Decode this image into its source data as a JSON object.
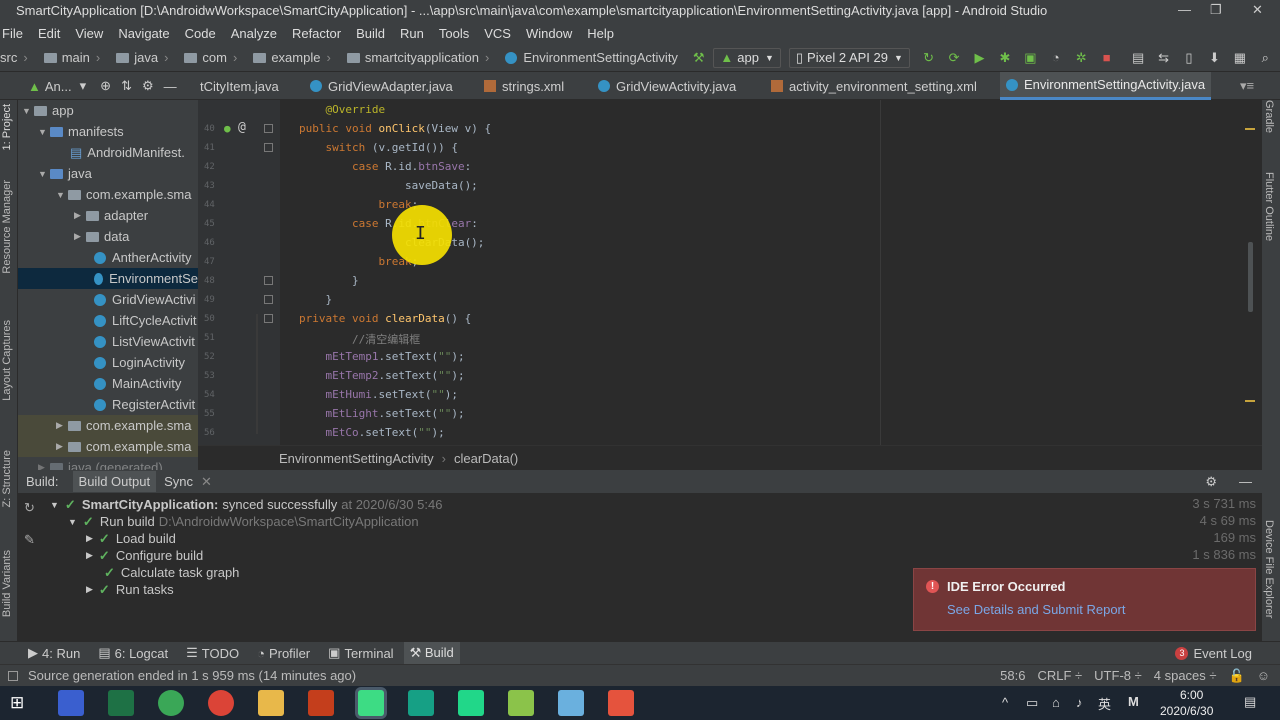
{
  "titlebar": {
    "title": "SmartCityApplication [D:\\AndroidwWorkspace\\SmartCityApplication] - ...\\app\\src\\main\\java\\com\\example\\smartcityapplication\\EnvironmentSettingActivity.java [app] - Android Studio"
  },
  "menu": [
    "File",
    "Edit",
    "View",
    "Navigate",
    "Code",
    "Analyze",
    "Refactor",
    "Build",
    "Run",
    "Tools",
    "VCS",
    "Window",
    "Help"
  ],
  "breadcrumbs": [
    "src",
    "main",
    "java",
    "com",
    "example",
    "smartcityapplication",
    "EnvironmentSettingActivity"
  ],
  "toolbar": {
    "config": "app",
    "device": "Pixel 2 API 29"
  },
  "tabs": [
    "tCityItem.java",
    "GridViewAdapter.java",
    "strings.xml",
    "GridViewActivity.java",
    "activity_environment_setting.xml",
    "EnvironmentSettingActivity.java"
  ],
  "project": {
    "header": "An...",
    "items": [
      {
        "label": "app",
        "level": 0,
        "arrow": "down"
      },
      {
        "label": "manifests",
        "level": 1,
        "arrow": "down"
      },
      {
        "label": "AndroidManifest.",
        "level": 2,
        "arrow": ""
      },
      {
        "label": "java",
        "level": 1,
        "arrow": "down"
      },
      {
        "label": "com.example.sma",
        "level": 2,
        "arrow": "down"
      },
      {
        "label": "adapter",
        "level": 3,
        "arrow": "right"
      },
      {
        "label": "data",
        "level": 3,
        "arrow": "right"
      },
      {
        "label": "AntherActivity",
        "level": 3,
        "arrow": ""
      },
      {
        "label": "EnvironmentSe",
        "level": 3,
        "arrow": ""
      },
      {
        "label": "GridViewActivi",
        "level": 3,
        "arrow": ""
      },
      {
        "label": "LiftCycleActivit",
        "level": 3,
        "arrow": ""
      },
      {
        "label": "ListViewActivit",
        "level": 3,
        "arrow": ""
      },
      {
        "label": "LoginActivity",
        "level": 3,
        "arrow": ""
      },
      {
        "label": "MainActivity",
        "level": 3,
        "arrow": ""
      },
      {
        "label": "RegisterActivit",
        "level": 3,
        "arrow": ""
      },
      {
        "label": "com.example.sma",
        "level": 2,
        "arrow": "right"
      },
      {
        "label": "com.example.sma",
        "level": 2,
        "arrow": "right"
      },
      {
        "label": "java (generated)",
        "level": 1,
        "arrow": "right"
      }
    ]
  },
  "left_strip": [
    "1: Project",
    "Resource Manager",
    "Layout Captures",
    "Z: Structure",
    "Build Variants"
  ],
  "right_strip": [
    "Gradle",
    "Flutter Outline",
    "Device File Explorer"
  ],
  "gutter_lines": [
    "",
    "40",
    "41",
    "42",
    "43",
    "44",
    "45",
    "46",
    "47",
    "48",
    "49",
    "50",
    "51",
    "52",
    "53",
    "54",
    "55",
    "56"
  ],
  "code": [
    "    @Override",
    "    public void onClick(View v) {",
    "        switch (v.getId()) {",
    "            case R.id.btnSave:",
    "                saveData();",
    "                break;",
    "            case R.id.btnClear:",
    "                clearData();",
    "                break;",
    "        }",
    "    }",
    "    private void clearData() {",
    "        //清空编辑框",
    "        mEtTemp1.setText(\"\");",
    "        mEtTemp2.setText(\"\");",
    "        mEtHumi.setText(\"\");",
    "        mEtLight.setText(\"\");",
    "        mEtCo.setText(\"\");"
  ],
  "editor_crumbs": [
    "EnvironmentSettingActivity",
    "clearData()"
  ],
  "build": {
    "tabs": [
      "Build:",
      "Build Output",
      "Sync"
    ],
    "rows": [
      {
        "label": "SmartCityApplication:",
        "extra": "synced successfully",
        "suffix": "at 2020/6/30 5:46",
        "time": "3 s 731 ms",
        "level": 0
      },
      {
        "label": "Run build",
        "extra": "",
        "suffix": "D:\\AndroidwWorkspace\\SmartCityApplication",
        "time": "4 s 69 ms",
        "level": 1
      },
      {
        "label": "Load build",
        "extra": "",
        "suffix": "",
        "time": "169 ms",
        "level": 2
      },
      {
        "label": "Configure build",
        "extra": "",
        "suffix": "",
        "time": "1 s 836 ms",
        "level": 2
      },
      {
        "label": "Calculate task graph",
        "extra": "",
        "suffix": "",
        "time": "",
        "level": 2
      },
      {
        "label": "Run tasks",
        "extra": "",
        "suffix": "",
        "time": "",
        "level": 2
      }
    ]
  },
  "toast": {
    "title": "IDE Error Occurred",
    "link": "See Details and Submit Report"
  },
  "toolwindows": [
    "4: Run",
    "6: Logcat",
    "TODO",
    "Profiler",
    "Terminal",
    "Build"
  ],
  "event_log": {
    "count": "3",
    "label": "Event Log"
  },
  "status": {
    "message": "Source generation ended in 1 s 959 ms (14 minutes ago)",
    "position": "58:6",
    "line_sep": "CRLF ÷",
    "encoding": "UTF-8 ÷",
    "indent": "4 spaces ÷"
  },
  "taskbar": {
    "time": "6:00",
    "date": "2020/6/30",
    "ime": "英"
  }
}
